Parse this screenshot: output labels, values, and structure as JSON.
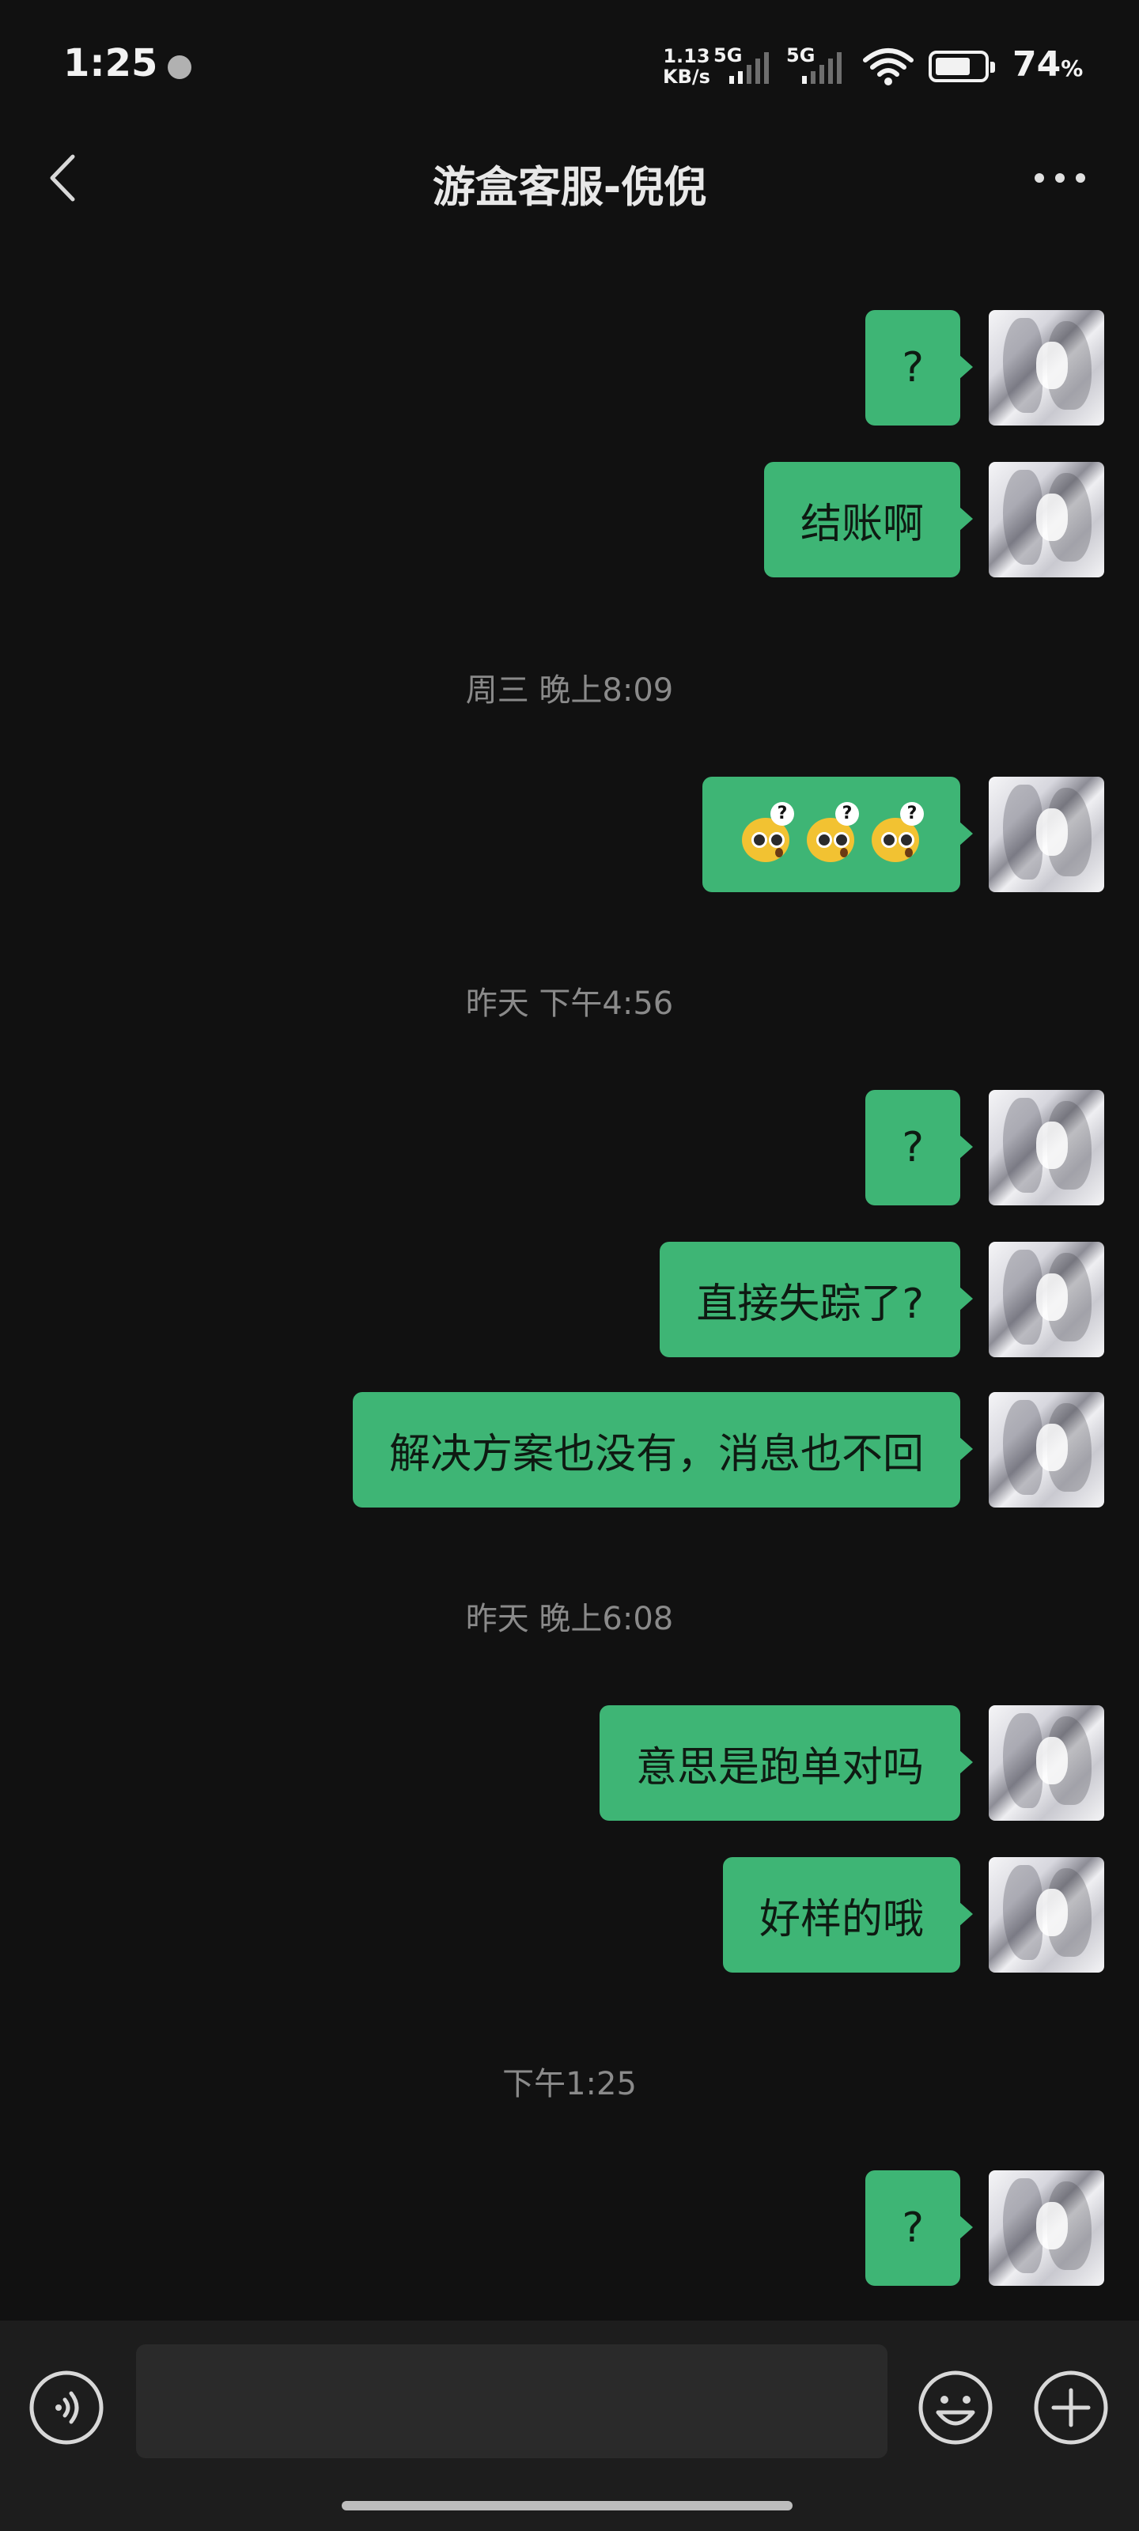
{
  "status_bar": {
    "time": "1:25",
    "net_speed_value": "1.13",
    "net_speed_unit": "KB/s",
    "sim1_label": "5G",
    "sim2_label": "5G",
    "battery_value": "74",
    "battery_unit": "%",
    "battery_level": 0.74,
    "icons": [
      "notification-dot-icon",
      "signal-icon",
      "wifi-icon",
      "battery-icon"
    ]
  },
  "header": {
    "title": "游盒客服-倪倪",
    "back_icon": "chevron-left-icon",
    "more_icon": "more-dots-icon"
  },
  "messages": [
    {
      "type": "msg",
      "text": "?"
    },
    {
      "type": "msg",
      "text": "结账啊"
    },
    {
      "type": "time",
      "text": "周三 晚上8:09"
    },
    {
      "type": "emoji",
      "emoji_name": "confused-face-emoji",
      "count": 3
    },
    {
      "type": "time",
      "text": "昨天 下午4:56"
    },
    {
      "type": "msg",
      "text": "?"
    },
    {
      "type": "msg",
      "text": "直接失踪了?"
    },
    {
      "type": "msg",
      "text": "解决方案也没有，消息也不回"
    },
    {
      "type": "time",
      "text": "昨天 晚上6:08"
    },
    {
      "type": "msg",
      "text": "意思是跑单对吗"
    },
    {
      "type": "msg",
      "text": "好样的哦"
    },
    {
      "type": "time",
      "text": "下午1:25"
    },
    {
      "type": "msg",
      "text": "?"
    }
  ],
  "input_bar": {
    "value": "",
    "placeholder": "",
    "icons": [
      "voice-icon",
      "emoji-icon",
      "plus-icon"
    ]
  },
  "colors": {
    "background": "#111111",
    "bubble": "#3eb575",
    "timestamp_text": "#8a8a8a",
    "input_bar": "#1d1d1d"
  }
}
